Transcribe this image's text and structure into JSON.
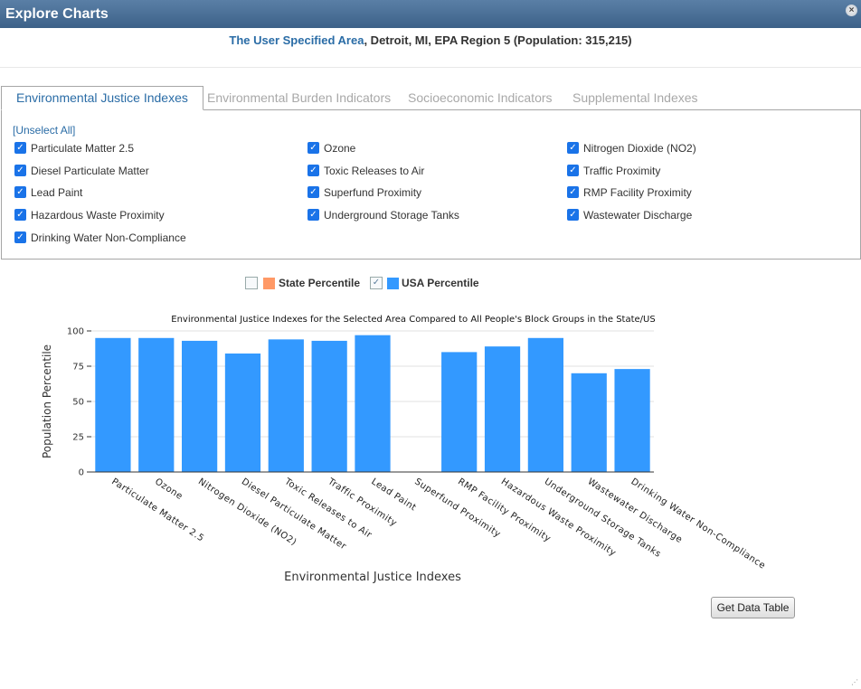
{
  "window": {
    "title": "Explore Charts"
  },
  "header": {
    "area_link": "The User Specified Area",
    "area_rest": ", Detroit, MI, EPA Region 5 (Population: 315,215)"
  },
  "tabs": [
    {
      "label": "Environmental Justice Indexes",
      "active": true
    },
    {
      "label": "Environmental Burden Indicators",
      "active": false
    },
    {
      "label": "Socioeconomic Indicators",
      "active": false
    },
    {
      "label": "Supplemental Indexes",
      "active": false
    }
  ],
  "unselect_label": "[Unselect All]",
  "checkboxes": [
    {
      "label": "Particulate Matter 2.5",
      "checked": true
    },
    {
      "label": "Ozone",
      "checked": true
    },
    {
      "label": "Nitrogen Dioxide (NO2)",
      "checked": true
    },
    {
      "label": "Diesel Particulate Matter",
      "checked": true
    },
    {
      "label": "Toxic Releases to Air",
      "checked": true
    },
    {
      "label": "Traffic Proximity",
      "checked": true
    },
    {
      "label": "Lead Paint",
      "checked": true
    },
    {
      "label": "Superfund Proximity",
      "checked": true
    },
    {
      "label": "RMP Facility Proximity",
      "checked": true
    },
    {
      "label": "Hazardous Waste Proximity",
      "checked": true
    },
    {
      "label": "Underground Storage Tanks",
      "checked": true
    },
    {
      "label": "Wastewater Discharge",
      "checked": true
    },
    {
      "label": "Drinking Water Non-Compliance",
      "checked": true
    }
  ],
  "legend": {
    "state_label": "State Percentile",
    "usa_label": "USA Percentile",
    "state_checked": false,
    "usa_checked": true,
    "state_color": "#ff9966",
    "usa_color": "#3399ff"
  },
  "chart_data": {
    "type": "bar",
    "title": "Environmental Justice Indexes for the Selected Area Compared to All People's Block Groups in the State/US",
    "xlabel": "Environmental Justice Indexes",
    "ylabel": "Population Percentile",
    "ylim": [
      0,
      100
    ],
    "yticks": [
      0,
      25,
      50,
      75,
      100
    ],
    "grid": true,
    "categories": [
      "Particulate Matter 2.5",
      "Ozone",
      "Nitrogen Dioxide (NO2)",
      "Diesel Particulate Matter",
      "Toxic Releases to Air",
      "Traffic Proximity",
      "Lead Paint",
      "Superfund Proximity",
      "RMP Facility Proximity",
      "Hazardous Waste Proximity",
      "Underground Storage Tanks",
      "Wastewater Discharge",
      "Drinking Water Non-Compliance"
    ],
    "series": [
      {
        "name": "USA Percentile",
        "color": "#3399ff",
        "values": [
          95,
          95,
          93,
          84,
          94,
          93,
          97,
          null,
          85,
          89,
          95,
          70,
          73
        ]
      }
    ]
  },
  "button_label": "Get Data Table"
}
